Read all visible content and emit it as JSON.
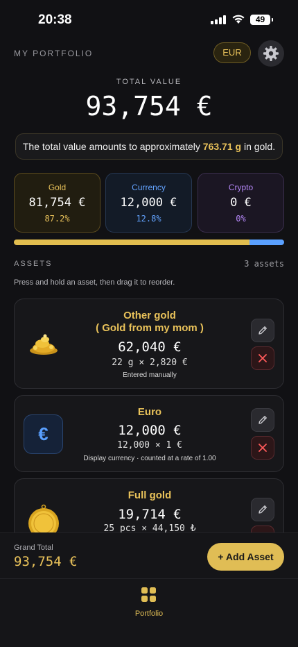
{
  "status": {
    "time": "20:38",
    "battery": "49"
  },
  "header": {
    "title": "MY PORTFOLIO",
    "currency": "EUR"
  },
  "total": {
    "label": "TOTAL VALUE",
    "value": "93,754 €"
  },
  "note": {
    "prefix": "The total value amounts to approximately",
    "grams": "763.71 g",
    "suffix": "in gold."
  },
  "categories": [
    {
      "label": "Gold",
      "value": "81,754 €",
      "percent": "87.2%",
      "color": "#e9c25a"
    },
    {
      "label": "Currency",
      "value": "12,000 €",
      "percent": "12.8%",
      "color": "#63a3ff"
    },
    {
      "label": "Crypto",
      "value": "0 €",
      "percent": "0%",
      "color": "#b386f5"
    }
  ],
  "allocation": {
    "gold": 0.872,
    "currency": 0.128,
    "crypto": 0
  },
  "assets_section": {
    "label": "ASSETS",
    "count": "3 assets",
    "hint": "Press and hold an asset, then drag it to reorder."
  },
  "assets": [
    {
      "name": "Other gold",
      "note": "( Gold from my mom )",
      "amount": "62,040 €",
      "calc": "22 g × 2,820 €",
      "sub": "Entered manually",
      "icon": "gold-pile-icon"
    },
    {
      "name": "Euro",
      "amount": "12,000 €",
      "calc": "12,000 × 1 €",
      "sub": "Display currency · counted at a rate of 1.00",
      "icon_glyph": "€",
      "icon": "euro-icon"
    },
    {
      "name": "Full gold",
      "amount": "19,714 €",
      "calc": "25 pcs × 44,150 ₺",
      "icon": "gold-coin-icon"
    }
  ],
  "footer": {
    "grand_label": "Grand Total",
    "grand_value": "93,754 €",
    "add_label": "+ Add Asset"
  },
  "tabbar": {
    "portfolio": "Portfolio"
  },
  "colors": {
    "gold": "#e0bd55",
    "currency": "#5aa0ff",
    "delete": "#ff5a5a",
    "background": "#111114"
  }
}
